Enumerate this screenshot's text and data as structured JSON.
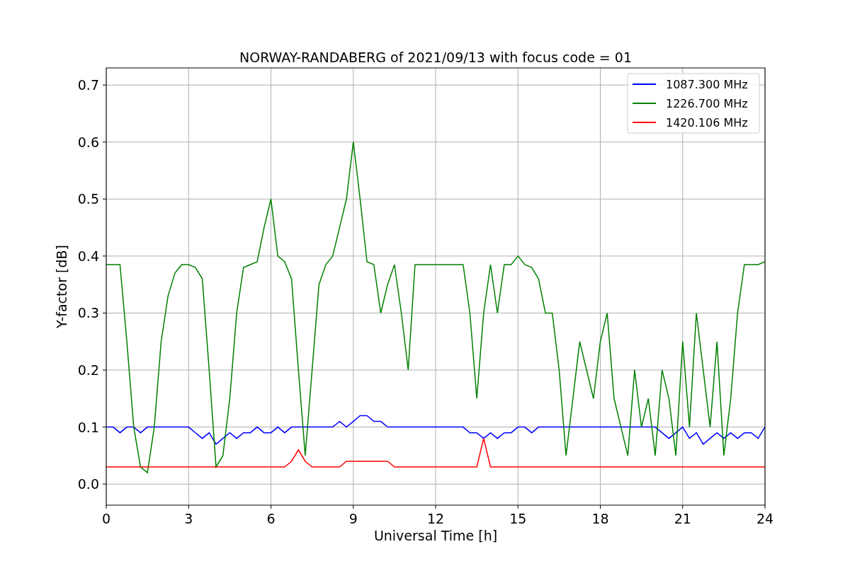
{
  "chart_data": {
    "type": "line",
    "title": "NORWAY-RANDABERG of 2021/09/13 with focus code = 01",
    "xlabel": "Universal Time [h]",
    "ylabel": "Y-factor [dB]",
    "x": [
      0,
      0.25,
      0.5,
      0.75,
      1,
      1.25,
      1.5,
      1.75,
      2,
      2.25,
      2.5,
      2.75,
      3,
      3.25,
      3.5,
      3.75,
      4,
      4.25,
      4.5,
      4.75,
      5,
      5.25,
      5.5,
      5.75,
      6,
      6.25,
      6.5,
      6.75,
      7,
      7.25,
      7.5,
      7.75,
      8,
      8.25,
      8.5,
      8.75,
      9,
      9.25,
      9.5,
      9.75,
      10,
      10.25,
      10.5,
      10.75,
      11,
      11.25,
      11.5,
      11.75,
      12,
      12.25,
      12.5,
      12.75,
      13,
      13.25,
      13.5,
      13.75,
      14,
      14.25,
      14.5,
      14.75,
      15,
      15.25,
      15.5,
      15.75,
      16,
      16.25,
      16.5,
      16.75,
      17,
      17.25,
      17.5,
      17.75,
      18,
      18.25,
      18.5,
      18.75,
      19,
      19.25,
      19.5,
      19.75,
      20,
      20.25,
      20.5,
      20.75,
      21,
      21.25,
      21.5,
      21.75,
      22,
      22.25,
      22.5,
      22.75,
      23,
      23.25,
      23.5,
      23.75,
      24
    ],
    "series": [
      {
        "name": "1087.300 MHz",
        "color": "#0000ff",
        "values": [
          0.1,
          0.1,
          0.09,
          0.1,
          0.1,
          0.09,
          0.1,
          0.1,
          0.1,
          0.1,
          0.1,
          0.1,
          0.1,
          0.09,
          0.08,
          0.09,
          0.07,
          0.08,
          0.09,
          0.08,
          0.09,
          0.09,
          0.1,
          0.09,
          0.09,
          0.1,
          0.09,
          0.1,
          0.1,
          0.1,
          0.1,
          0.1,
          0.1,
          0.1,
          0.11,
          0.1,
          0.11,
          0.12,
          0.12,
          0.11,
          0.11,
          0.1,
          0.1,
          0.1,
          0.1,
          0.1,
          0.1,
          0.1,
          0.1,
          0.1,
          0.1,
          0.1,
          0.1,
          0.09,
          0.09,
          0.08,
          0.09,
          0.08,
          0.09,
          0.09,
          0.1,
          0.1,
          0.09,
          0.1,
          0.1,
          0.1,
          0.1,
          0.1,
          0.1,
          0.1,
          0.1,
          0.1,
          0.1,
          0.1,
          0.1,
          0.1,
          0.1,
          0.1,
          0.1,
          0.1,
          0.1,
          0.09,
          0.08,
          0.09,
          0.1,
          0.08,
          0.09,
          0.07,
          0.08,
          0.09,
          0.08,
          0.09,
          0.08,
          0.09,
          0.09,
          0.08,
          0.1
        ]
      },
      {
        "name": "1226.700 MHz",
        "color": "#008000",
        "values": [
          0.385,
          0.385,
          0.385,
          0.25,
          0.1,
          0.03,
          0.02,
          0.1,
          0.25,
          0.33,
          0.37,
          0.385,
          0.385,
          0.38,
          0.36,
          0.2,
          0.03,
          0.05,
          0.15,
          0.3,
          0.38,
          0.385,
          0.39,
          0.45,
          0.5,
          0.4,
          0.39,
          0.36,
          0.2,
          0.05,
          0.2,
          0.35,
          0.385,
          0.4,
          0.45,
          0.5,
          0.6,
          0.5,
          0.39,
          0.385,
          0.3,
          0.35,
          0.385,
          0.3,
          0.2,
          0.385,
          0.385,
          0.385,
          0.385,
          0.385,
          0.385,
          0.385,
          0.385,
          0.3,
          0.15,
          0.3,
          0.385,
          0.3,
          0.385,
          0.385,
          0.4,
          0.385,
          0.38,
          0.36,
          0.3,
          0.3,
          0.2,
          0.05,
          0.15,
          0.25,
          0.2,
          0.15,
          0.25,
          0.3,
          0.15,
          0.1,
          0.05,
          0.2,
          0.1,
          0.15,
          0.05,
          0.2,
          0.15,
          0.05,
          0.25,
          0.1,
          0.3,
          0.2,
          0.1,
          0.25,
          0.05,
          0.15,
          0.3,
          0.385,
          0.385,
          0.385,
          0.39
        ]
      },
      {
        "name": "1420.106 MHz",
        "color": "#ff0000",
        "values": [
          0.03,
          0.03,
          0.03,
          0.03,
          0.03,
          0.03,
          0.03,
          0.03,
          0.03,
          0.03,
          0.03,
          0.03,
          0.03,
          0.03,
          0.03,
          0.03,
          0.03,
          0.03,
          0.03,
          0.03,
          0.03,
          0.03,
          0.03,
          0.03,
          0.03,
          0.03,
          0.03,
          0.04,
          0.06,
          0.04,
          0.03,
          0.03,
          0.03,
          0.03,
          0.03,
          0.04,
          0.04,
          0.04,
          0.04,
          0.04,
          0.04,
          0.04,
          0.03,
          0.03,
          0.03,
          0.03,
          0.03,
          0.03,
          0.03,
          0.03,
          0.03,
          0.03,
          0.03,
          0.03,
          0.03,
          0.08,
          0.03,
          0.03,
          0.03,
          0.03,
          0.03,
          0.03,
          0.03,
          0.03,
          0.03,
          0.03,
          0.03,
          0.03,
          0.03,
          0.03,
          0.03,
          0.03,
          0.03,
          0.03,
          0.03,
          0.03,
          0.03,
          0.03,
          0.03,
          0.03,
          0.03,
          0.03,
          0.03,
          0.03,
          0.03,
          0.03,
          0.03,
          0.03,
          0.03,
          0.03,
          0.03,
          0.03,
          0.03,
          0.03,
          0.03,
          0.03,
          0.03
        ]
      }
    ],
    "grid": true,
    "legend": "upper right",
    "xlim": [
      0,
      24
    ],
    "ylim": [
      -0.037,
      0.73
    ],
    "xticks": [
      0,
      3,
      6,
      9,
      12,
      15,
      18,
      21,
      24
    ],
    "yticks": [
      {
        "value": 0,
        "label": "0.0"
      },
      {
        "value": 0.1,
        "label": "0.1"
      },
      {
        "value": 0.2,
        "label": "0.2"
      },
      {
        "value": 0.3,
        "label": "0.3"
      },
      {
        "value": 0.4,
        "label": "0.4"
      },
      {
        "value": 0.5,
        "label": "0.5"
      },
      {
        "value": 0.6,
        "label": "0.6"
      },
      {
        "value": 0.7,
        "label": "0.7"
      }
    ]
  }
}
